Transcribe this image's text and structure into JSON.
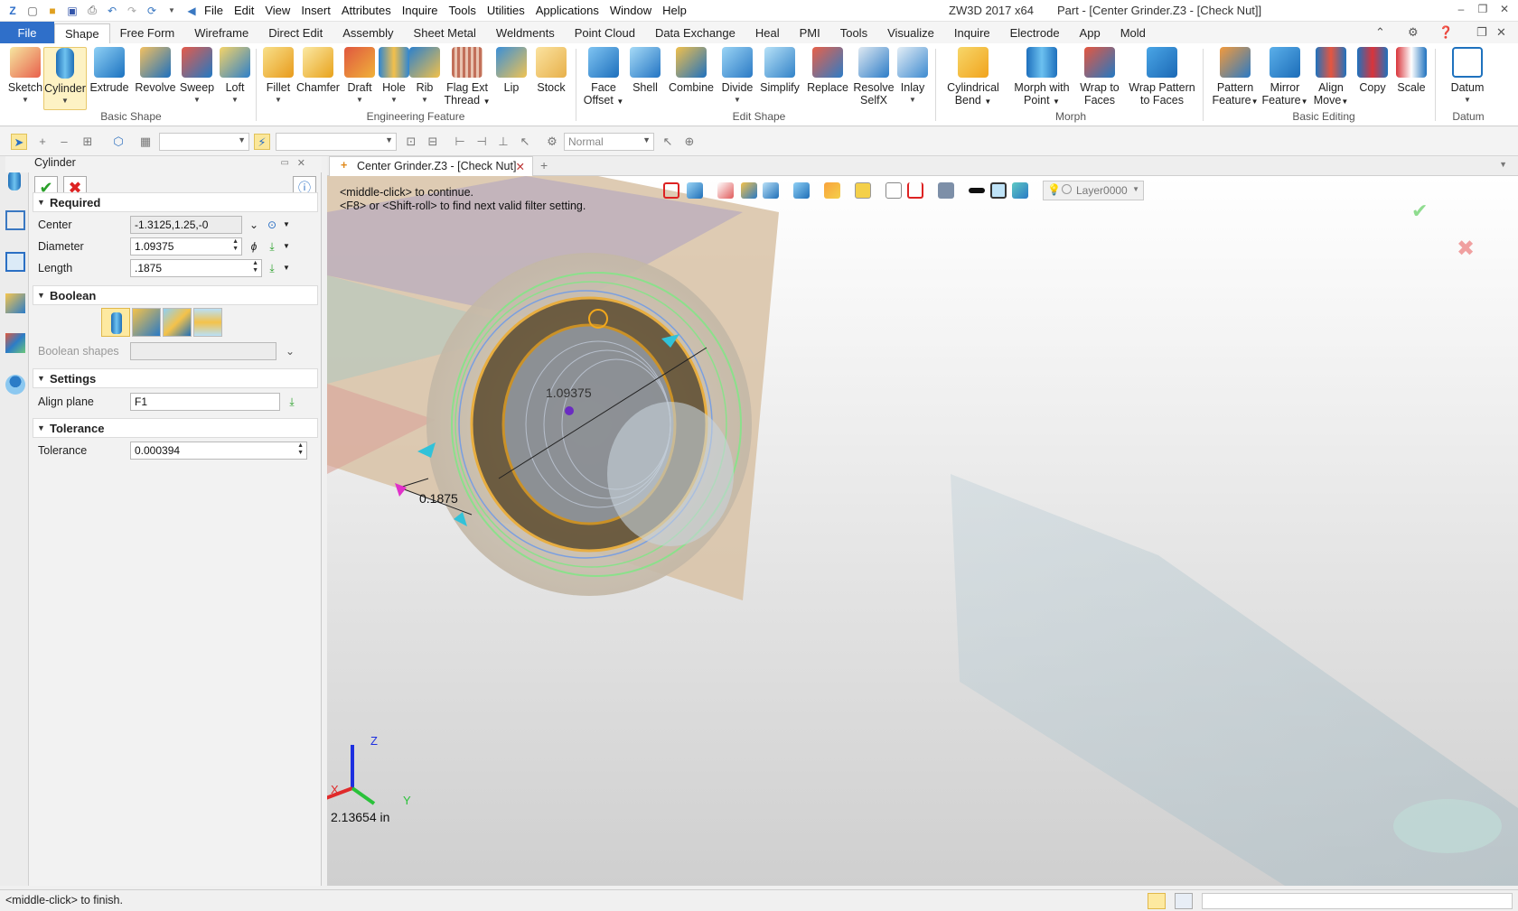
{
  "titlebar": {
    "menu": [
      "File",
      "Edit",
      "View",
      "Insert",
      "Attributes",
      "Inquire",
      "Tools",
      "Utilities",
      "Applications",
      "Window",
      "Help"
    ],
    "app_name": "ZW3D 2017  x64",
    "document_title": "Part - [Center Grinder.Z3 - [Check Nut]]"
  },
  "ribbon_tabs": [
    "File",
    "Shape",
    "Free Form",
    "Wireframe",
    "Direct Edit",
    "Assembly",
    "Sheet Metal",
    "Weldments",
    "Point Cloud",
    "Data Exchange",
    "Heal",
    "PMI",
    "Tools",
    "Visualize",
    "Inquire",
    "Electrode",
    "App",
    "Mold"
  ],
  "ribbon": {
    "groups": {
      "basic_shape": "Basic Shape",
      "engineering_feature": "Engineering Feature",
      "edit_shape": "Edit Shape",
      "morph": "Morph",
      "basic_editing": "Basic Editing",
      "datum": "Datum"
    },
    "buttons": {
      "sketch": "Sketch",
      "cylinder": "Cylinder",
      "extrude": "Extrude",
      "revolve": "Revolve",
      "sweep": "Sweep",
      "loft": "Loft",
      "fillet": "Fillet",
      "chamfer": "Chamfer",
      "draft": "Draft",
      "hole": "Hole",
      "rib": "Rib",
      "flag_ext_1": "Flag Ext",
      "flag_ext_2": "Thread",
      "lip": "Lip",
      "stock": "Stock",
      "face_offset_1": "Face",
      "face_offset_2": "Offset",
      "shell": "Shell",
      "combine": "Combine",
      "divide": "Divide",
      "simplify": "Simplify",
      "replace": "Replace",
      "resolve_1": "Resolve",
      "resolve_2": "SelfX",
      "inlay": "Inlay",
      "cyl_bend_1": "Cylindrical",
      "cyl_bend_2": "Bend",
      "morph_point_1": "Morph with",
      "morph_point_2": "Point",
      "wrap_faces_1": "Wrap to",
      "wrap_faces_2": "Faces",
      "wrap_pattern_1": "Wrap Pattern",
      "wrap_pattern_2": "to Faces",
      "pattern_1": "Pattern",
      "pattern_2": "Feature",
      "mirror_1": "Mirror",
      "mirror_2": "Feature",
      "align_1": "Align",
      "align_2": "Move",
      "copy": "Copy",
      "scale": "Scale",
      "datum": "Datum"
    }
  },
  "toolbar2": {
    "render_mode": "Normal"
  },
  "panel": {
    "title": "Cylinder",
    "sections": {
      "required": "Required",
      "boolean": "Boolean",
      "settings": "Settings",
      "tolerance": "Tolerance"
    },
    "fields": {
      "center_label": "Center",
      "center_value": "-1.3125,1.25,-0",
      "diameter_label": "Diameter",
      "diameter_value": "1.09375",
      "length_label": "Length",
      "length_value": ".1875",
      "boolean_shapes_label": "Boolean shapes",
      "align_plane_label": "Align plane",
      "align_plane_value": "F1",
      "tolerance_label": "Tolerance",
      "tolerance_value": "0.000394"
    }
  },
  "viewport": {
    "doc_tab": "Center Grinder.Z3 - [Check Nut]",
    "hint_1": "<middle-click> to continue.",
    "hint_2": "<F8> or <Shift-roll> to find next valid filter setting.",
    "diameter_dim": "1.09375",
    "length_dim": "0.1875",
    "scale_readout": "2.13654 in",
    "layer": "Layer0000",
    "axis_x": "X",
    "axis_y": "Y",
    "axis_z": "Z"
  },
  "statusbar": {
    "message": "<middle-click> to finish."
  },
  "colors": {
    "file_tab": "#2f6fc9",
    "accent_orange": "#f2a81c",
    "preview_green": "#8be08b"
  }
}
